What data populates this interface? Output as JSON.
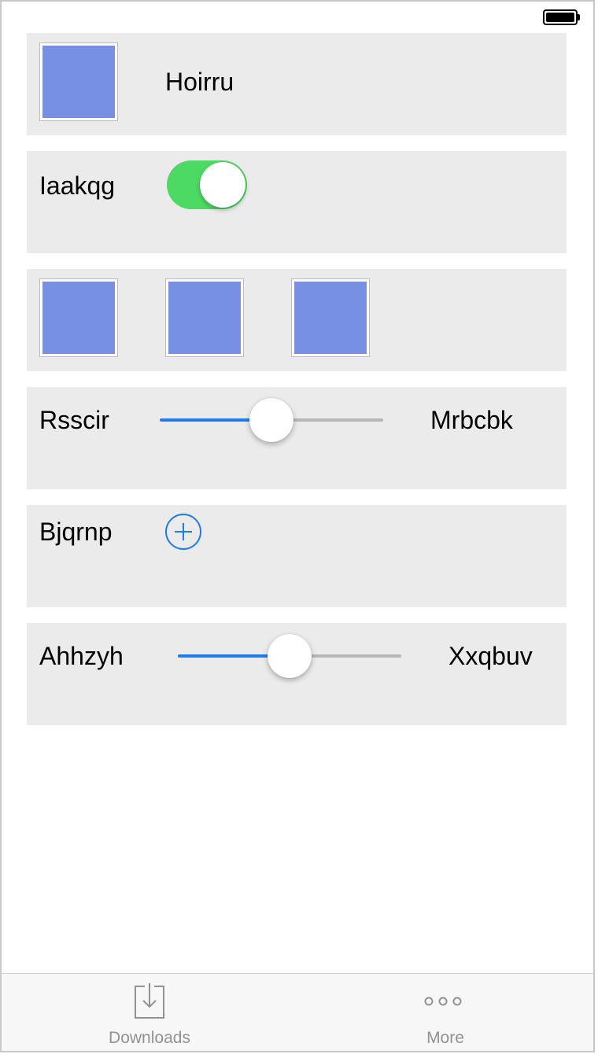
{
  "status_bar": {
    "battery": "full"
  },
  "rows": [
    {
      "type": "image-label",
      "label": "Hoirru"
    },
    {
      "type": "toggle",
      "label": "Iaakqg",
      "toggle_on": true
    },
    {
      "type": "images",
      "count": 3
    },
    {
      "type": "slider",
      "label_left": "Rsscir",
      "label_right": "Mrbcbk",
      "value": 0.5
    },
    {
      "type": "add",
      "label": "Bjqrnp"
    },
    {
      "type": "slider",
      "label_left": "Ahhzyh",
      "label_right": "Xxqbuv",
      "value": 0.5
    }
  ],
  "colors": {
    "image_fill": "#7890e4",
    "toggle_on": "#4cd964",
    "accent": "#1f7cf0",
    "row_bg": "#ebebeb"
  },
  "tabbar": {
    "tabs": [
      {
        "label": "Downloads",
        "icon": "downloads-icon"
      },
      {
        "label": "More",
        "icon": "more-icon"
      }
    ]
  }
}
